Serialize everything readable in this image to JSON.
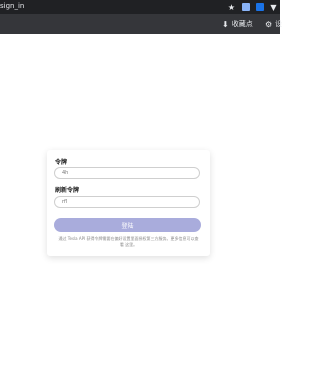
{
  "browser": {
    "url_fragment": "sign_in",
    "icons": [
      "star-icon",
      "extension-icon",
      "extension-icon",
      "extension-icon"
    ],
    "bookmarks": [
      {
        "label": "收藏点",
        "icon": "download-icon"
      },
      {
        "label": "设",
        "icon": "gear-icon"
      }
    ]
  },
  "form": {
    "token_label": "令牌",
    "token_placeholder": "4h",
    "refresh_label": "刷新令牌",
    "refresh_placeholder": "rfl",
    "submit_label": "登陆",
    "note": "通过 Tesla API 获得令牌需要在偏好设置里面授权第三方服务。更多信息可以查看 这里。",
    "accent": "#a9acdc"
  }
}
